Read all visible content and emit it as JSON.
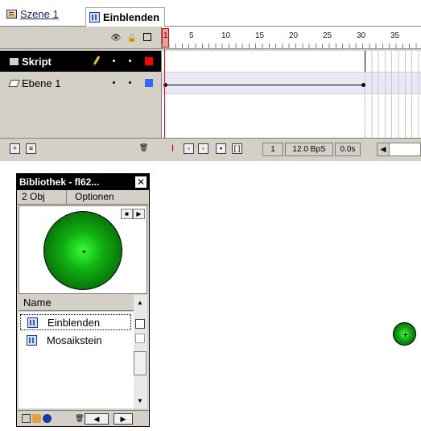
{
  "breadcrumb": {
    "scene_label": "Szene 1",
    "symbol_label": "Einblenden"
  },
  "timeline": {
    "ruler_labels": [
      "1",
      "5",
      "10",
      "15",
      "20",
      "25",
      "30",
      "35"
    ],
    "layers": [
      {
        "name": "Skript",
        "active": true,
        "color": "#ff0000"
      },
      {
        "name": "Ebene 1",
        "active": false,
        "color": "#3366ff"
      }
    ],
    "status": {
      "current_frame": "1",
      "frame_rate": "12.0 BpS",
      "elapsed": "0.0s"
    }
  },
  "library": {
    "title": "Bibliothek - fl62...",
    "count": "2 Obj",
    "options_label": "Optionen",
    "column_name": "Name",
    "items": [
      {
        "name": "Einblenden",
        "icon": "movieclip-icon",
        "selected": true
      },
      {
        "name": "Mosaikstein",
        "icon": "movieclip-icon",
        "selected": false
      }
    ]
  },
  "colors": {
    "playhead": "#ff0000",
    "circle_center": "#33ff33",
    "circle_edge": "#053a05"
  }
}
